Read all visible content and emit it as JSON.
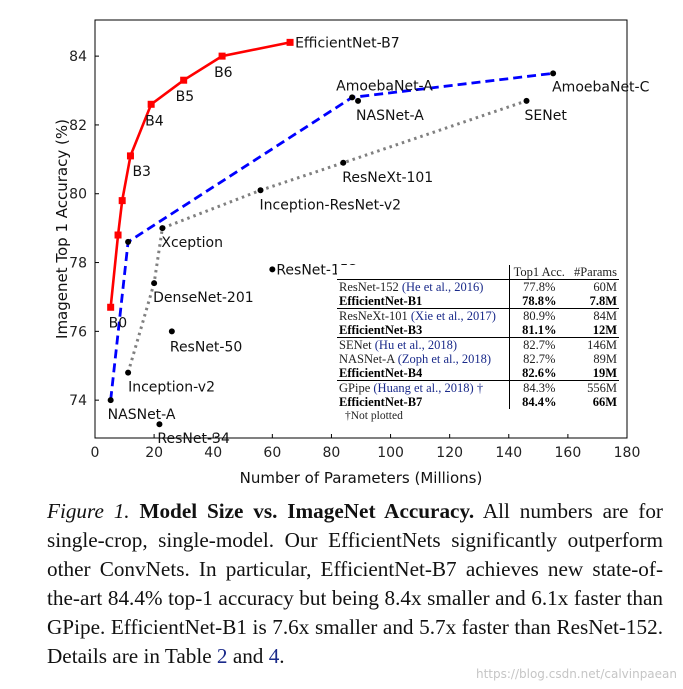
{
  "chart_data": {
    "type": "line",
    "xlabel": "Number of Parameters (Millions)",
    "ylabel": "Imagenet Top 1 Accuracy (%)",
    "xlim": [
      0,
      180
    ],
    "ylim": [
      72.9,
      85.05
    ],
    "xticks": [
      0,
      20,
      40,
      60,
      80,
      100,
      120,
      140,
      160,
      180
    ],
    "yticks": [
      74,
      76,
      78,
      80,
      82,
      84
    ],
    "grid": false,
    "series": [
      {
        "style": "solid",
        "color": "#ff0000",
        "marker": "square",
        "points": [
          {
            "x": 5.3,
            "y": 76.7,
            "label": "B0"
          },
          {
            "x": 7.8,
            "y": 78.8,
            "label": ""
          },
          {
            "x": 9.2,
            "y": 79.8,
            "label": ""
          },
          {
            "x": 12,
            "y": 81.1,
            "label": "B3"
          },
          {
            "x": 19,
            "y": 82.6,
            "label": "B4"
          },
          {
            "x": 30,
            "y": 83.3,
            "label": "B5"
          },
          {
            "x": 43,
            "y": 84.0,
            "label": "B6"
          },
          {
            "x": 66,
            "y": 84.4,
            "label": "EfficientNet-B7"
          }
        ]
      },
      {
        "style": "dashed",
        "color": "#0000ff",
        "marker": "dot",
        "points": [
          {
            "x": 5.3,
            "y": 74.0,
            "label": "NASNet-A"
          },
          {
            "x": 11.2,
            "y": 78.6,
            "label": ""
          },
          {
            "x": 87,
            "y": 82.8,
            "label": "AmoebaNet-A"
          },
          {
            "x": 155,
            "y": 83.5,
            "label": "AmoebaNet-C"
          }
        ]
      },
      {
        "style": "dotted",
        "color": "#808080",
        "marker": "dot",
        "points": [
          {
            "x": 11.2,
            "y": 74.8,
            "label": "Inception-v2"
          },
          {
            "x": 20,
            "y": 77.4,
            "label": "DenseNet-201"
          },
          {
            "x": 22.8,
            "y": 79.0,
            "label": "Xception"
          },
          {
            "x": 56,
            "y": 80.1,
            "label": "Inception-ResNet-v2"
          },
          {
            "x": 84,
            "y": 80.9,
            "label": "ResNeXt-101"
          },
          {
            "x": 146,
            "y": 82.7,
            "label": "SENet"
          }
        ]
      }
    ],
    "standalone_points": [
      {
        "x": 89,
        "y": 82.7,
        "label": "NASNet-A"
      },
      {
        "x": 60,
        "y": 77.8,
        "label": "ResNet-152"
      },
      {
        "x": 26,
        "y": 76.0,
        "label": "ResNet-50"
      },
      {
        "x": 21.8,
        "y": 73.3,
        "label": "ResNet-34"
      }
    ],
    "table": {
      "headers": [
        "",
        "Top1 Acc.",
        "#Params"
      ],
      "groups": [
        [
          {
            "model": "ResNet-152",
            "cite": "(He et al., 2016)",
            "acc": "77.8%",
            "params": "60M",
            "bold": false
          },
          {
            "model": "EfficientNet-B1",
            "cite": "",
            "acc": "78.8%",
            "params": "7.8M",
            "bold": true
          }
        ],
        [
          {
            "model": "ResNeXt-101",
            "cite": "(Xie et al., 2017)",
            "acc": "80.9%",
            "params": "84M",
            "bold": false
          },
          {
            "model": "EfficientNet-B3",
            "cite": "",
            "acc": "81.1%",
            "params": "12M",
            "bold": true
          }
        ],
        [
          {
            "model": "SENet",
            "cite": "(Hu et al., 2018)",
            "acc": "82.7%",
            "params": "146M",
            "bold": false
          },
          {
            "model": "NASNet-A",
            "cite": "(Zoph et al., 2018)",
            "acc": "82.7%",
            "params": "89M",
            "bold": false
          },
          {
            "model": "EfficientNet-B4",
            "cite": "",
            "acc": "82.6%",
            "params": "19M",
            "bold": true
          }
        ],
        [
          {
            "model": "GPipe",
            "cite": "(Huang et al., 2018) †",
            "acc": "84.3%",
            "params": "556M",
            "bold": false
          },
          {
            "model": "EfficientNet-B7",
            "cite": "",
            "acc": "84.4%",
            "params": "66M",
            "bold": true
          }
        ]
      ],
      "footnote": "†Not plotted"
    }
  },
  "caption": {
    "figure": "Figure 1.",
    "title": "Model Size vs. ImageNet Accuracy.",
    "text1": "All numbers are for single-crop, single-model. Our EfficientNets significantly outperform other ConvNets. In particular, EfficientNet-B7 achieves new state-of-the-art 84.4% top-1 accuracy but being 8.4x smaller and 6.1x faster than GPipe. EfficientNet-B1 is 7.6x smaller and 5.7x faster than ResNet-152. Details are in Table",
    "ref1": "2",
    "and": "and",
    "ref2": "4",
    "end": "."
  },
  "watermark": "https://blog.csdn.net/calvinpaean"
}
